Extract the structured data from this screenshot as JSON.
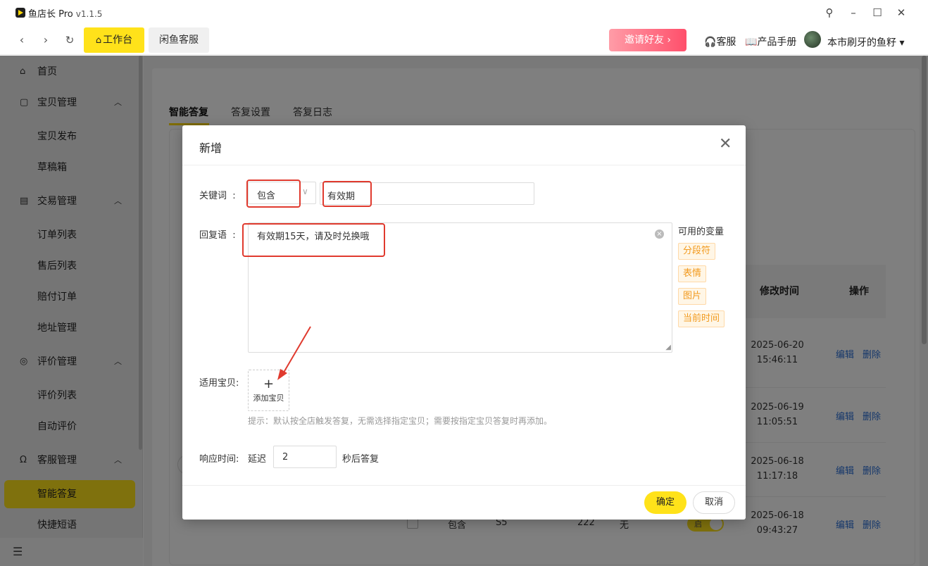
{
  "app": {
    "title": "鱼店长 Pro",
    "version": "v1.1.5"
  },
  "toolbar": {
    "home_tab": "工作台",
    "service_tab": "闲鱼客服",
    "invite": "邀请好友",
    "support": "客服",
    "manual": "产品手册",
    "username": "本市刷牙的鱼籽"
  },
  "sidebar": {
    "home": "首页",
    "goods": "宝贝管理",
    "goods_publish": "宝贝发布",
    "drafts": "草稿箱",
    "trade": "交易管理",
    "orders": "订单列表",
    "aftersale": "售后列表",
    "compensation": "赔付订单",
    "address": "地址管理",
    "review": "评价管理",
    "review_list": "评价列表",
    "auto_review": "自动评价",
    "cs": "客服管理",
    "smart_reply": "智能答复",
    "quick_phrases": "快捷短语"
  },
  "main": {
    "tabs": [
      "智能答复",
      "答复设置",
      "答复日志"
    ],
    "table": {
      "col_modified": "修改时间",
      "col_actions": "操作",
      "edit": "编辑",
      "delete": "删除",
      "rows": [
        {
          "date": "2025-06-20",
          "time": "15:46:11"
        },
        {
          "date": "2025-06-19",
          "time": "11:05:51"
        },
        {
          "date": "2025-06-18",
          "time": "11:17:18"
        },
        {
          "date": "2025-06-18",
          "time": "09:43:27",
          "match": "包含",
          "keyword": "S5",
          "num": "222",
          "goods": "无",
          "toggle": "启"
        }
      ]
    }
  },
  "modal": {
    "title": "新增",
    "keyword_label": "关键词",
    "match_type": "包含",
    "keyword": "有效期",
    "reply_label": "回复语",
    "reply_text": "有效期15天，请及时兑换哦",
    "vars_title": "可用的变量",
    "vars": [
      "分段符",
      "表情",
      "图片",
      "当前时间"
    ],
    "goods_label": "适用宝贝:",
    "add_goods": "添加宝贝",
    "hint": "提示：默认按全店触发答复，无需选择指定宝贝；需要按指定宝贝答复时再添加。",
    "response_label": "响应时间:",
    "delay_prefix": "延迟",
    "delay_value": "2",
    "delay_suffix": "秒后答复",
    "confirm": "确定",
    "cancel": "取消"
  },
  "colors": {
    "accent": "#ffe21a",
    "link": "#2b6fd6",
    "annotation": "#e03a2e",
    "var_tag": "#f29a1e"
  }
}
